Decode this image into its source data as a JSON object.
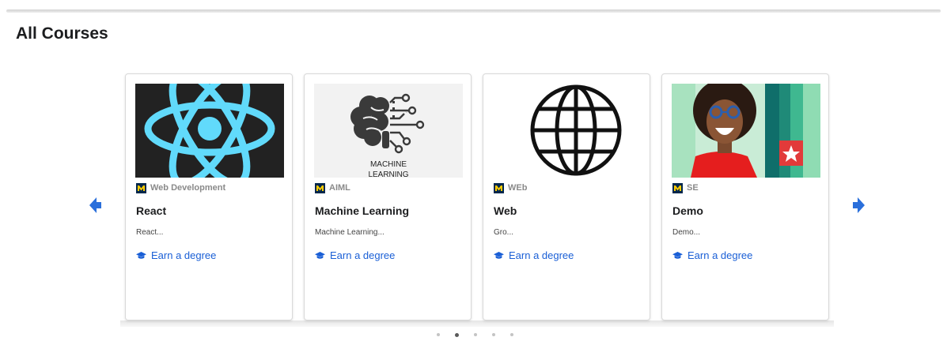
{
  "page": {
    "title": "All Courses"
  },
  "carousel": {
    "active_dot": 1,
    "dot_count": 5,
    "courses": [
      {
        "partner": "Web Development",
        "title": "React",
        "description": "React...",
        "cta": "Earn a degree",
        "image": "react-logo"
      },
      {
        "partner": "AIML",
        "title": "Machine Learning",
        "description": "Machine Learning...",
        "cta": "Earn a degree",
        "image": "machine-learning-brain",
        "image_text": [
          "MACHINE",
          "LEARNING"
        ]
      },
      {
        "partner": "WEb",
        "title": "Web",
        "description": "Gro...",
        "cta": "Earn a degree",
        "image": "globe"
      },
      {
        "partner": "SE",
        "title": "Demo",
        "description": "Demo...",
        "cta": "Earn a degree",
        "image": "smiling-person-photo"
      }
    ]
  },
  "colors": {
    "link": "#1a5fd6",
    "arrow": "#2a6fdb",
    "react_bg": "#222222",
    "react_logo": "#61dafb",
    "partner_logo_bg": "#00274c",
    "partner_logo_fg": "#ffcb05"
  }
}
